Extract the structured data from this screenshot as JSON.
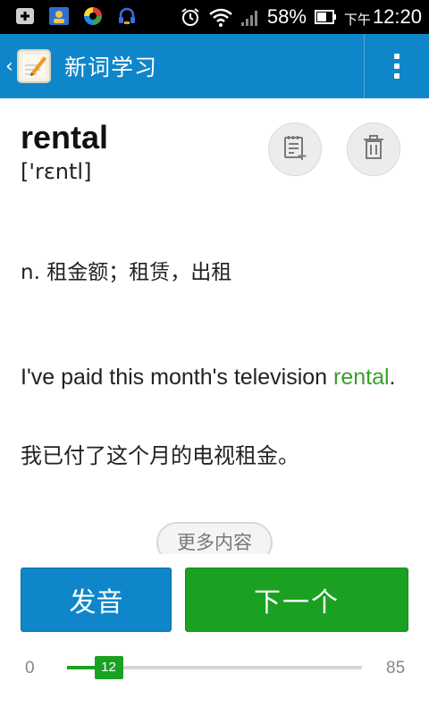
{
  "status_bar": {
    "battery_percent": "58%",
    "time_prefix": "下午",
    "time": "12:20",
    "left_icons": [
      "add-notification-icon",
      "contacts-app-icon",
      "colorful-app-icon",
      "headset-app-icon"
    ],
    "right_icons": [
      "alarm-icon",
      "wifi-icon",
      "signal-icon",
      "battery-icon"
    ]
  },
  "app_bar": {
    "title": "新词学习",
    "back_icon": "chevron-left-icon",
    "logo_icon": "notepad-logo-icon",
    "menu_icon": "overflow-menu-icon",
    "color": "#0f86c9"
  },
  "word": {
    "headword": "rental",
    "phonetic": "['rɛntl]",
    "definition": "n. 租金额；租赁，出租",
    "example_before": "I've paid this month's television ",
    "example_highlight": "rental",
    "example_after": ".",
    "translation": "我已付了这个月的电视租金。",
    "highlight_color": "#3aa02b"
  },
  "actions": {
    "add_to_notebook_icon": "add-note-icon",
    "delete_icon": "trash-icon",
    "more_label": "更多内容",
    "pronounce_label": "发音",
    "next_label": "下一个"
  },
  "progress": {
    "min": "0",
    "max": "85",
    "current": "12",
    "fraction": 0.141
  }
}
